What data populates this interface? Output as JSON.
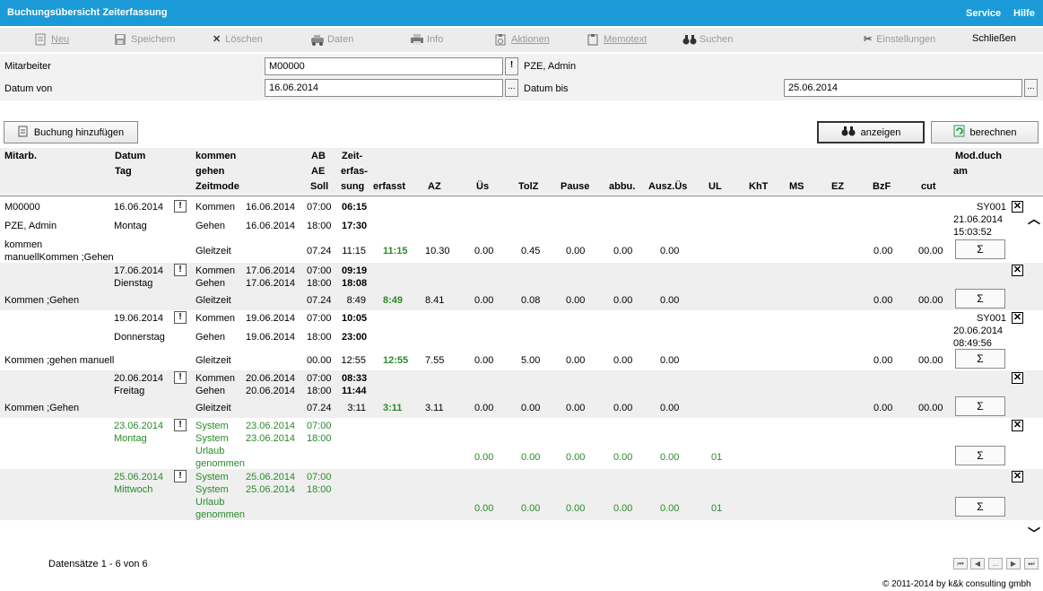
{
  "title": "Buchungsübersicht Zeiterfassung",
  "header_links": {
    "service": "Service",
    "help": "Hilfe"
  },
  "toolbar": {
    "new": "Neu",
    "save": "Speichern",
    "delete": "Löschen",
    "data": "Daten",
    "info": "Info",
    "actions": "Aktionen",
    "memo": "Memotext",
    "search": "Suchen",
    "settings": "Einstellungen",
    "close": "Schließen"
  },
  "filters": {
    "employee_label": "Mitarbeiter",
    "employee_value": "M00000",
    "employee_name": "PZE, Admin",
    "date_from_label": "Datum von",
    "date_from_value": "16.06.2014",
    "date_to_label": "Datum bis",
    "date_to_value": "25.06.2014",
    "ellipsis": "..."
  },
  "buttons": {
    "add_booking": "Buchung hinzufügen",
    "show": "anzeigen",
    "calculate": "berechnen"
  },
  "columns": {
    "emp": "Mitarb.",
    "date1": "Datum",
    "date2": "Tag",
    "kg1": "kommen",
    "kg2": "gehen",
    "kg3": "Zeitmode",
    "ab1": "AB",
    "ab2": "AE",
    "ab3": "Soll",
    "ze1": "Zeit-",
    "ze2": "erfas-",
    "ze3": "sung",
    "erf": "erfasst",
    "az": "AZ",
    "us": "Üs",
    "tolz": "TolZ",
    "pause": "Pause",
    "abbu": "abbu.",
    "auszus": "Ausz.Üs",
    "ul": "UL",
    "kht": "KhT",
    "ms": "MS",
    "ez": "EZ",
    "bzf": "BzF",
    "cut": "cut",
    "mod1": "Mod.duch",
    "mod2": "am"
  },
  "rows": [
    {
      "emp": "M00000",
      "emp2": "PZE, Admin",
      "note": "kommen\nmanuellKommen ;Gehen",
      "date": "16.06.2014",
      "day": "Montag",
      "k_type": "Kommen",
      "k_date": "16.06.2014",
      "ab": "07:00",
      "k_time": "06:15",
      "g_type": "Gehen",
      "g_date": "16.06.2014",
      "ae": "18:00",
      "g_time": "17:30",
      "mode": "Gleitzeit",
      "soll": "07.24",
      "ze": "11:15",
      "erf": "11:15",
      "az": "10.30",
      "us": "0.00",
      "tolz": "0.45",
      "pause": "0.00",
      "abbu": "0.00",
      "auszus": "0.00",
      "ul": "",
      "bzf": "0.00",
      "cut": "00.00",
      "mod_by": "SY001",
      "mod_date": "21.06.2014",
      "mod_time": "15:03:52",
      "sigma": "Σ",
      "x": "✕",
      "excl": "!"
    },
    {
      "emp": "",
      "note": "Kommen ;Gehen",
      "date": "17.06.2014",
      "day": "Dienstag",
      "k_type": "Kommen",
      "k_date": "17.06.2014",
      "ab": "07:00",
      "k_time": "09:19",
      "g_type": "Gehen",
      "g_date": "17.06.2014",
      "ae": "18:00",
      "g_time": "18:08",
      "mode": "Gleitzeit",
      "soll": "07.24",
      "ze": "8:49",
      "erf": "8:49",
      "az": "8.41",
      "us": "0.00",
      "tolz": "0.08",
      "pause": "0.00",
      "abbu": "0.00",
      "auszus": "0.00",
      "ul": "",
      "bzf": "0.00",
      "cut": "00.00",
      "mod_by": "",
      "mod_date": "",
      "mod_time": "",
      "sigma": "Σ",
      "x": "✕",
      "excl": "!"
    },
    {
      "emp": "",
      "note": "Kommen ;gehen manuell",
      "date": "19.06.2014",
      "day": "Donnerstag",
      "k_type": "Kommen",
      "k_date": "19.06.2014",
      "ab": "07:00",
      "k_time": "10:05",
      "g_type": "Gehen",
      "g_date": "19.06.2014",
      "ae": "18:00",
      "g_time": "23:00",
      "mode": "Gleitzeit",
      "soll": "00.00",
      "ze": "12:55",
      "erf": "12:55",
      "az": "7.55",
      "us": "0.00",
      "tolz": "5.00",
      "pause": "0.00",
      "abbu": "0.00",
      "auszus": "0.00",
      "ul": "",
      "bzf": "0.00",
      "cut": "00.00",
      "mod_by": "SY001",
      "mod_date": "20.06.2014",
      "mod_time": "08:49:56",
      "sigma": "Σ",
      "x": "✕",
      "excl": "!"
    },
    {
      "emp": "",
      "note": "Kommen ;Gehen",
      "date": "20.06.2014",
      "day": "Freitag",
      "k_type": "Kommen",
      "k_date": "20.06.2014",
      "ab": "07:00",
      "k_time": "08:33",
      "g_type": "Gehen",
      "g_date": "20.06.2014",
      "ae": "18:00",
      "g_time": "11:44",
      "mode": "Gleitzeit",
      "soll": "07.24",
      "ze": "3:11",
      "erf": "3:11",
      "az": "3.11",
      "us": "0.00",
      "tolz": "0.00",
      "pause": "0.00",
      "abbu": "0.00",
      "auszus": "0.00",
      "ul": "",
      "bzf": "0.00",
      "cut": "00.00",
      "mod_by": "",
      "mod_date": "",
      "mod_time": "",
      "sigma": "Σ",
      "x": "✕",
      "excl": "!"
    },
    {
      "emp": "",
      "note": "",
      "date": "23.06.2014",
      "day": "Montag",
      "k_type": "System",
      "k_date": "23.06.2014",
      "ab": "07:00",
      "k_time": "",
      "g_type": "System",
      "g_date": "23.06.2014",
      "ae": "18:00",
      "g_time": "",
      "mode": "Urlaub genommen",
      "mode1": "Urlaub",
      "mode2": "genommen",
      "soll": "",
      "ze": "",
      "erf": "",
      "az": "",
      "us": "0.00",
      "tolz": "0.00",
      "pause": "0.00",
      "abbu": "0.00",
      "auszus": "0.00",
      "ul": "01",
      "bzf": "",
      "cut": "",
      "mod_by": "",
      "mod_date": "",
      "mod_time": "",
      "sigma": "Σ",
      "x": "✕",
      "excl": "!"
    },
    {
      "emp": "",
      "note": "",
      "date": "25.06.2014",
      "day": "Mittwoch",
      "k_type": "System",
      "k_date": "25.06.2014",
      "ab": "07:00",
      "k_time": "",
      "g_type": "System",
      "g_date": "25.06.2014",
      "ae": "18:00",
      "g_time": "",
      "mode": "Urlaub genommen",
      "mode1": "Urlaub",
      "mode2": "genommen",
      "soll": "",
      "ze": "",
      "erf": "",
      "az": "",
      "us": "0.00",
      "tolz": "0.00",
      "pause": "0.00",
      "abbu": "0.00",
      "auszus": "0.00",
      "ul": "01",
      "bzf": "",
      "cut": "",
      "mod_by": "",
      "mod_date": "",
      "mod_time": "",
      "sigma": "Σ",
      "x": "✕",
      "excl": "!"
    }
  ],
  "footer": {
    "records": "Datensätze 1 - 6 von 6",
    "copyright": "© 2011-2014 by k&k consulting gmbh"
  },
  "pager": [
    "⏮",
    "◀",
    "...",
    "▶",
    "⏭"
  ],
  "colors": {
    "accent": "#1a9bd7",
    "green": "#2a8a2a",
    "band": "#efefef"
  }
}
